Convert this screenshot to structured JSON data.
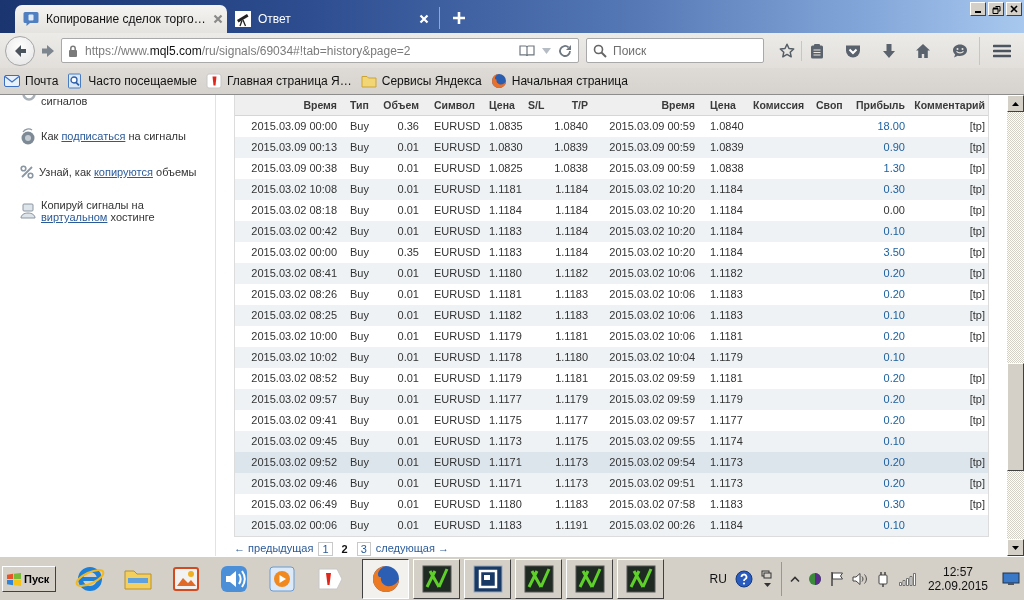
{
  "tabs": [
    {
      "title": "Копирование сделок торго…",
      "selected": true
    },
    {
      "title": "Ответ",
      "selected": false
    }
  ],
  "address_bar": {
    "prefix": "https://www.",
    "domain": "mql5.com",
    "path": "/ru/signals/69034#!tab=history&page=2"
  },
  "search": {
    "placeholder": "Поиск"
  },
  "bookmarks": [
    "Почта",
    "Часто посещаемые",
    "Главная страница Я…",
    "Сервисы Яндекса",
    "Начальная страница"
  ],
  "sidebar": {
    "items": [
      {
        "text": "сигналов"
      },
      {
        "text": "Как",
        "link": "подписаться",
        "after": "на сигналы"
      },
      {
        "text": "Узнай, как",
        "link": "копируются",
        "after": "объемы"
      },
      {
        "text": "Копируй сигналы на",
        "link": "виртуальном",
        "after": "хостинге"
      }
    ]
  },
  "table": {
    "columns": [
      "Время",
      "Тип",
      "Объем",
      "Символ",
      "Цена",
      "S/L",
      "T/P",
      "Время",
      "Цена",
      "Комиссия",
      "Своп",
      "Прибыль",
      "Комментарий"
    ],
    "rows": [
      {
        "open_time": "2015.03.09 00:00",
        "type": "Buy",
        "volume": "0.36",
        "symbol": "EURUSD",
        "open_price": "1.0835",
        "tp": "1.0840",
        "close_time": "2015.03.09 00:59",
        "close_price": "1.0840",
        "profit": "18.00",
        "gain": true,
        "comment": "[tp]",
        "selected": false
      },
      {
        "open_time": "2015.03.09 00:13",
        "type": "Buy",
        "volume": "0.01",
        "symbol": "EURUSD",
        "open_price": "1.0830",
        "tp": "1.0839",
        "close_time": "2015.03.09 00:59",
        "close_price": "1.0839",
        "profit": "0.90",
        "gain": true,
        "comment": "[tp]",
        "selected": false
      },
      {
        "open_time": "2015.03.09 00:38",
        "type": "Buy",
        "volume": "0.01",
        "symbol": "EURUSD",
        "open_price": "1.0825",
        "tp": "1.0838",
        "close_time": "2015.03.09 00:59",
        "close_price": "1.0838",
        "profit": "1.30",
        "gain": true,
        "comment": "[tp]",
        "selected": false
      },
      {
        "open_time": "2015.03.02 10:08",
        "type": "Buy",
        "volume": "0.01",
        "symbol": "EURUSD",
        "open_price": "1.1181",
        "tp": "1.1184",
        "close_time": "2015.03.02 10:20",
        "close_price": "1.1184",
        "profit": "0.30",
        "gain": true,
        "comment": "[tp]",
        "selected": false
      },
      {
        "open_time": "2015.03.02 08:18",
        "type": "Buy",
        "volume": "0.01",
        "symbol": "EURUSD",
        "open_price": "1.1184",
        "tp": "1.1184",
        "close_time": "2015.03.02 10:20",
        "close_price": "1.1184",
        "profit": "0.00",
        "gain": false,
        "comment": "[tp]",
        "selected": false
      },
      {
        "open_time": "2015.03.02 00:42",
        "type": "Buy",
        "volume": "0.01",
        "symbol": "EURUSD",
        "open_price": "1.1183",
        "tp": "1.1184",
        "close_time": "2015.03.02 10:20",
        "close_price": "1.1184",
        "profit": "0.10",
        "gain": true,
        "comment": "[tp]",
        "selected": false
      },
      {
        "open_time": "2015.03.02 00:00",
        "type": "Buy",
        "volume": "0.35",
        "symbol": "EURUSD",
        "open_price": "1.1183",
        "tp": "1.1184",
        "close_time": "2015.03.02 10:20",
        "close_price": "1.1184",
        "profit": "3.50",
        "gain": true,
        "comment": "[tp]",
        "selected": false
      },
      {
        "open_time": "2015.03.02 08:41",
        "type": "Buy",
        "volume": "0.01",
        "symbol": "EURUSD",
        "open_price": "1.1180",
        "tp": "1.1182",
        "close_time": "2015.03.02 10:06",
        "close_price": "1.1182",
        "profit": "0.20",
        "gain": true,
        "comment": "[tp]",
        "selected": false
      },
      {
        "open_time": "2015.03.02 08:26",
        "type": "Buy",
        "volume": "0.01",
        "symbol": "EURUSD",
        "open_price": "1.1181",
        "tp": "1.1183",
        "close_time": "2015.03.02 10:06",
        "close_price": "1.1183",
        "profit": "0.20",
        "gain": true,
        "comment": "[tp]",
        "selected": false
      },
      {
        "open_time": "2015.03.02 08:25",
        "type": "Buy",
        "volume": "0.01",
        "symbol": "EURUSD",
        "open_price": "1.1182",
        "tp": "1.1183",
        "close_time": "2015.03.02 10:06",
        "close_price": "1.1183",
        "profit": "0.10",
        "gain": true,
        "comment": "[tp]",
        "selected": false
      },
      {
        "open_time": "2015.03.02 10:00",
        "type": "Buy",
        "volume": "0.01",
        "symbol": "EURUSD",
        "open_price": "1.1179",
        "tp": "1.1181",
        "close_time": "2015.03.02 10:06",
        "close_price": "1.1181",
        "profit": "0.20",
        "gain": true,
        "comment": "[tp]",
        "selected": false
      },
      {
        "open_time": "2015.03.02 10:02",
        "type": "Buy",
        "volume": "0.01",
        "symbol": "EURUSD",
        "open_price": "1.1178",
        "tp": "1.1180",
        "close_time": "2015.03.02 10:04",
        "close_price": "1.1179",
        "profit": "0.10",
        "gain": true,
        "selected": false
      },
      {
        "open_time": "2015.03.02 08:52",
        "type": "Buy",
        "volume": "0.01",
        "symbol": "EURUSD",
        "open_price": "1.1179",
        "tp": "1.1181",
        "close_time": "2015.03.02 09:59",
        "close_price": "1.1181",
        "profit": "0.20",
        "gain": true,
        "comment": "[tp]",
        "selected": false
      },
      {
        "open_time": "2015.03.02 09:57",
        "type": "Buy",
        "volume": "0.01",
        "symbol": "EURUSD",
        "open_price": "1.1177",
        "tp": "1.1179",
        "close_time": "2015.03.02 09:59",
        "close_price": "1.1179",
        "profit": "0.20",
        "gain": true,
        "comment": "[tp]",
        "selected": false
      },
      {
        "open_time": "2015.03.02 09:41",
        "type": "Buy",
        "volume": "0.01",
        "symbol": "EURUSD",
        "open_price": "1.1175",
        "tp": "1.1177",
        "close_time": "2015.03.02 09:57",
        "close_price": "1.1177",
        "profit": "0.20",
        "gain": true,
        "comment": "[tp]",
        "selected": false
      },
      {
        "open_time": "2015.03.02 09:45",
        "type": "Buy",
        "volume": "0.01",
        "symbol": "EURUSD",
        "open_price": "1.1173",
        "tp": "1.1175",
        "close_time": "2015.03.02 09:55",
        "close_price": "1.1174",
        "profit": "0.10",
        "gain": true,
        "selected": false
      },
      {
        "open_time": "2015.03.02 09:52",
        "type": "Buy",
        "volume": "0.01",
        "symbol": "EURUSD",
        "open_price": "1.1171",
        "tp": "1.1173",
        "close_time": "2015.03.02 09:54",
        "close_price": "1.1173",
        "profit": "0.20",
        "gain": true,
        "comment": "[tp]",
        "selected": true
      },
      {
        "open_time": "2015.03.02 09:46",
        "type": "Buy",
        "volume": "0.01",
        "symbol": "EURUSD",
        "open_price": "1.1171",
        "tp": "1.1173",
        "close_time": "2015.03.02 09:51",
        "close_price": "1.1173",
        "profit": "0.20",
        "gain": true,
        "comment": "[tp]",
        "selected": false
      },
      {
        "open_time": "2015.03.02 06:49",
        "type": "Buy",
        "volume": "0.01",
        "symbol": "EURUSD",
        "open_price": "1.1180",
        "tp": "1.1183",
        "close_time": "2015.03.02 07:58",
        "close_price": "1.1183",
        "profit": "0.30",
        "gain": true,
        "comment": "[tp]",
        "selected": false
      },
      {
        "open_time": "2015.03.02 00:06",
        "type": "Buy",
        "volume": "0.01",
        "symbol": "EURUSD",
        "open_price": "1.1183",
        "tp": "1.1191",
        "close_time": "2015.03.02 00:26",
        "close_price": "1.1184",
        "profit": "0.10",
        "gain": true,
        "selected": false
      }
    ]
  },
  "pagination": {
    "previous": "← предыдущая",
    "pages": [
      {
        "label": "1",
        "selected": false
      },
      {
        "label": "2",
        "selected": true
      },
      {
        "label": "3",
        "selected": false
      }
    ],
    "next": "следующая →"
  },
  "taskbar": {
    "start": "Пуск",
    "windows": [
      {
        "kind": "browser",
        "selected": true
      },
      {
        "kind": "chart-app",
        "selected": false
      },
      {
        "kind": "p-app",
        "selected": false
      },
      {
        "kind": "chart-app",
        "selected": false
      },
      {
        "kind": "chart-app",
        "selected": false
      },
      {
        "kind": "chart-app",
        "selected": false
      }
    ],
    "language": "RU",
    "time": "12:57",
    "date": "22.09.2015"
  }
}
